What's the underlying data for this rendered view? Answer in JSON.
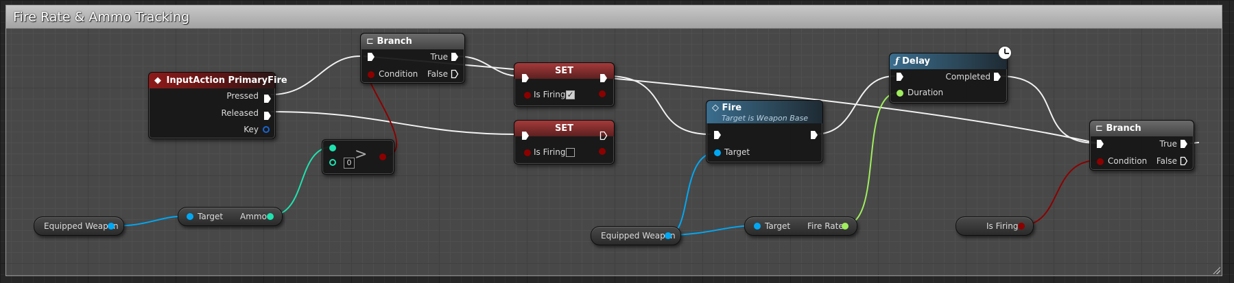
{
  "comment": {
    "title": "Fire Rate & Ammo Tracking"
  },
  "colors": {
    "exec": "#ffffff",
    "bool": "#8c0000",
    "object": "#00a8f4",
    "int": "#1fe3af",
    "float": "#a0ee5e",
    "struct": "#0a3b9a"
  },
  "nodes": {
    "input_action": {
      "title": "InputAction PrimaryFire",
      "pins": {
        "pressed": "Pressed",
        "released": "Released",
        "key": "Key"
      }
    },
    "branch1": {
      "title": "Branch",
      "pins": {
        "true": "True",
        "condition": "Condition",
        "false": "False"
      }
    },
    "set1": {
      "title": "SET",
      "pins": {
        "is_firing": "Is Firing"
      },
      "checked": true
    },
    "set2": {
      "title": "SET",
      "pins": {
        "is_firing": "Is Firing"
      },
      "checked": false
    },
    "compare": {
      "operator": ">",
      "value": "0"
    },
    "fire": {
      "title": "Fire",
      "subtitle": "Target is Weapon Base",
      "pins": {
        "target": "Target"
      }
    },
    "delay": {
      "title": "Delay",
      "pins": {
        "completed": "Completed",
        "duration": "Duration"
      }
    },
    "branch2": {
      "title": "Branch",
      "pins": {
        "true": "True",
        "condition": "Condition",
        "false": "False"
      }
    },
    "equipped1": {
      "label": "Equipped Weapon"
    },
    "get_ammo": {
      "target": "Target",
      "ammo": "Ammo"
    },
    "equipped2": {
      "label": "Equipped Weapon"
    },
    "get_fire_rate": {
      "target": "Target",
      "fire_rate": "Fire Rate"
    },
    "is_firing_get": {
      "label": "Is Firing"
    }
  }
}
